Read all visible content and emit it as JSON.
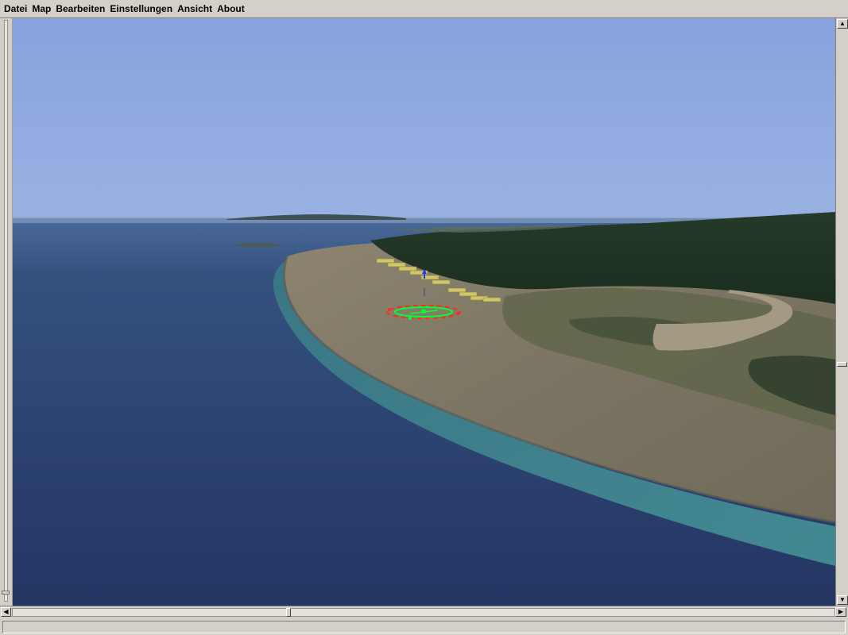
{
  "menu": {
    "items": [
      "Datei",
      "Map",
      "Bearbeiten",
      "Einstellungen",
      "Ansicht",
      "About"
    ]
  },
  "scrollbars": {
    "up_arrow": "▲",
    "down_arrow": "▼",
    "left_arrow": "◀",
    "right_arrow": "▶"
  },
  "status": {
    "text": ""
  },
  "scene": {
    "sky_color": "#8aa6de",
    "sea_color": "#2a3a66",
    "shallow_water_color": "#3f8f8e",
    "beach_color": "#7d7664",
    "forest_color": "#1f3423",
    "marker_green": "#00ff33",
    "marker_red": "#ff2a1a",
    "marker_blue": "#2233ff",
    "hangar_color": "#cfc66a"
  }
}
